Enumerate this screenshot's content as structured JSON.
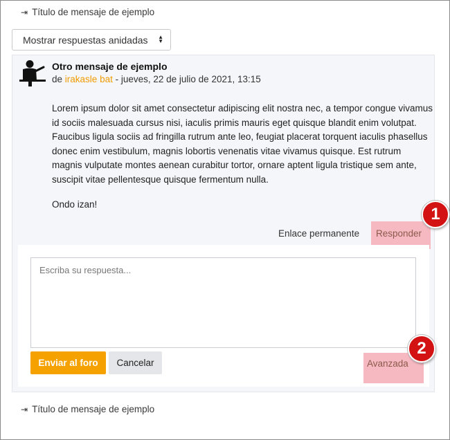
{
  "nav": {
    "top_link": "Título de mensaje de ejemplo",
    "bottom_link": "Título de mensaje de ejemplo"
  },
  "display_mode": {
    "selected": "Mostrar respuestas anidadas"
  },
  "post": {
    "title": "Otro mensaje de ejemplo",
    "by_prefix": "de",
    "author": "irakasle bat",
    "date": "- jueves, 22 de julio de 2021, 13:15",
    "paragraph1": "Lorem ipsum dolor sit amet consectetur adipiscing elit nostra nec, a tempor congue vivamus id sociis malesuada cursus nisi, iaculis primis mauris eget quisque blandit enim volutpat. Faucibus ligula sociis ad fringilla rutrum ante leo, feugiat placerat torquent iaculis phasellus donec enim vestibulum, magnis lobortis venenatis vitae vivamus quisque. Est rutrum magnis vulputate montes aenean curabitur tortor, ornare aptent ligula tristique sem ante, suscipit vitae pellentesque quisque fermentum nulla.",
    "paragraph2": "Ondo izan!",
    "permalink_label": "Enlace permanente",
    "reply_label": "Responder"
  },
  "reply_form": {
    "placeholder": "Escriba su respuesta...",
    "submit_label": "Enviar al foro",
    "cancel_label": "Cancelar",
    "advanced_label": "Avanzada"
  },
  "badges": {
    "first": "1",
    "second": "2"
  },
  "colors": {
    "accent": "#f5a200",
    "highlight": "#f6b9c2",
    "badge": "#d31313"
  }
}
